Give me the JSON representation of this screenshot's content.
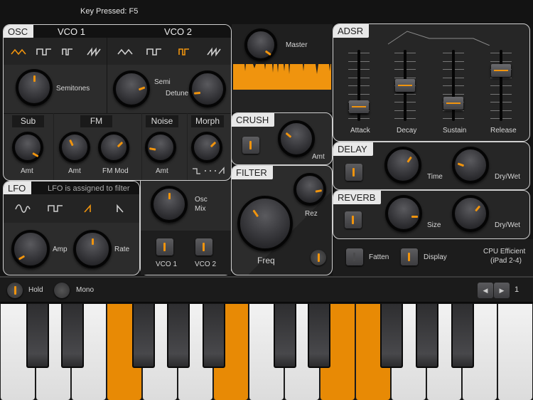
{
  "status": {
    "key_pressed": "Key Pressed: F5"
  },
  "osc": {
    "tab": "OSC",
    "vco1": {
      "header": "VCO 1",
      "waveforms": [
        "triangle",
        "square",
        "pulse",
        "saw"
      ],
      "selected": 0,
      "knob_label": "Semitones",
      "semitones": 0.5
    },
    "vco2": {
      "header": "VCO 2",
      "waveforms": [
        "triangle",
        "square",
        "pulse",
        "saw"
      ],
      "selected": 2,
      "semi_label": "Semi",
      "detune_label": "Detune",
      "semi": 0.7,
      "detune": 0.25
    },
    "sub": {
      "header": "Sub",
      "amt_label": "Amt",
      "amt": 0.85
    },
    "fm": {
      "header": "FM",
      "amt_label": "Amt",
      "fm_mod_label": "FM Mod",
      "amt": 0.42,
      "fm_mod": 0.62
    },
    "noise": {
      "header": "Noise",
      "amt_label": "Amt",
      "amt": 0.25
    },
    "morph": {
      "header": "Morph",
      "amt": 0.62,
      "range_icons": [
        "square-wave-icon",
        "dots",
        "saw-wave-icon"
      ]
    }
  },
  "lfo": {
    "tab": "LFO",
    "status": "LFO is assigned to filter",
    "waveforms": [
      "sine",
      "square",
      "ramp-up",
      "ramp-down"
    ],
    "selected": 2,
    "amp_label": "Amp",
    "rate_label": "Rate",
    "amp": 0.12,
    "rate": 0.5
  },
  "mix": {
    "knob_label_1": "Osc",
    "knob_label_2": "Mix",
    "osc_mix": 0.5,
    "vco1_label": "VCO 1",
    "vco2_label": "VCO 2",
    "vco1_on": true,
    "vco2_on": true
  },
  "master": {
    "label": "Master",
    "value": 0.8
  },
  "crush": {
    "tab": "CRUSH",
    "amt_label": "Amt",
    "amt": 0.38,
    "enabled": true
  },
  "filter": {
    "tab": "FILTER",
    "freq_label": "Freq",
    "rez_label": "Rez",
    "freq": 0.4,
    "rez": 0.7,
    "enabled": true
  },
  "adsr": {
    "tab": "ADSR",
    "sliders": [
      {
        "label": "Attack",
        "value": 0.18
      },
      {
        "label": "Decay",
        "value": 0.55
      },
      {
        "label": "Sustain",
        "value": 0.25
      },
      {
        "label": "Release",
        "value": 0.8
      }
    ]
  },
  "delay": {
    "tab": "DELAY",
    "time_label": "Time",
    "drywet_label": "Dry/Wet",
    "time": 0.62,
    "drywet": 0.28,
    "enabled": true
  },
  "reverb": {
    "tab": "REVERB",
    "size_label": "Size",
    "drywet_label": "Dry/Wet",
    "size": 0.75,
    "drywet": 0.62,
    "enabled": true
  },
  "options": {
    "fatten_label": "Fatten",
    "display_label": "Display",
    "fatten_on": false,
    "display_on": true,
    "cpu_line1": "CPU Efficient",
    "cpu_line2": "(iPad 2-4)"
  },
  "bottombar": {
    "hold_label": "Hold",
    "mono_label": "Mono",
    "hold_on": true,
    "mono_on": false,
    "octave": "1"
  },
  "keyboard": {
    "white_keys": [
      "C",
      "D",
      "E",
      "F",
      "G",
      "A",
      "B",
      "C",
      "D",
      "E",
      "F",
      "G",
      "A",
      "B",
      "C"
    ],
    "black_keys": [
      "C#",
      "D#",
      "F#",
      "G#",
      "A#",
      "C#",
      "D#",
      "F#",
      "G#",
      "A#"
    ],
    "pressed_white": [
      3,
      6,
      9,
      10
    ],
    "pressed_black": []
  },
  "colors": {
    "accent": "#f0940e",
    "key_pressed": "#e88a05"
  }
}
